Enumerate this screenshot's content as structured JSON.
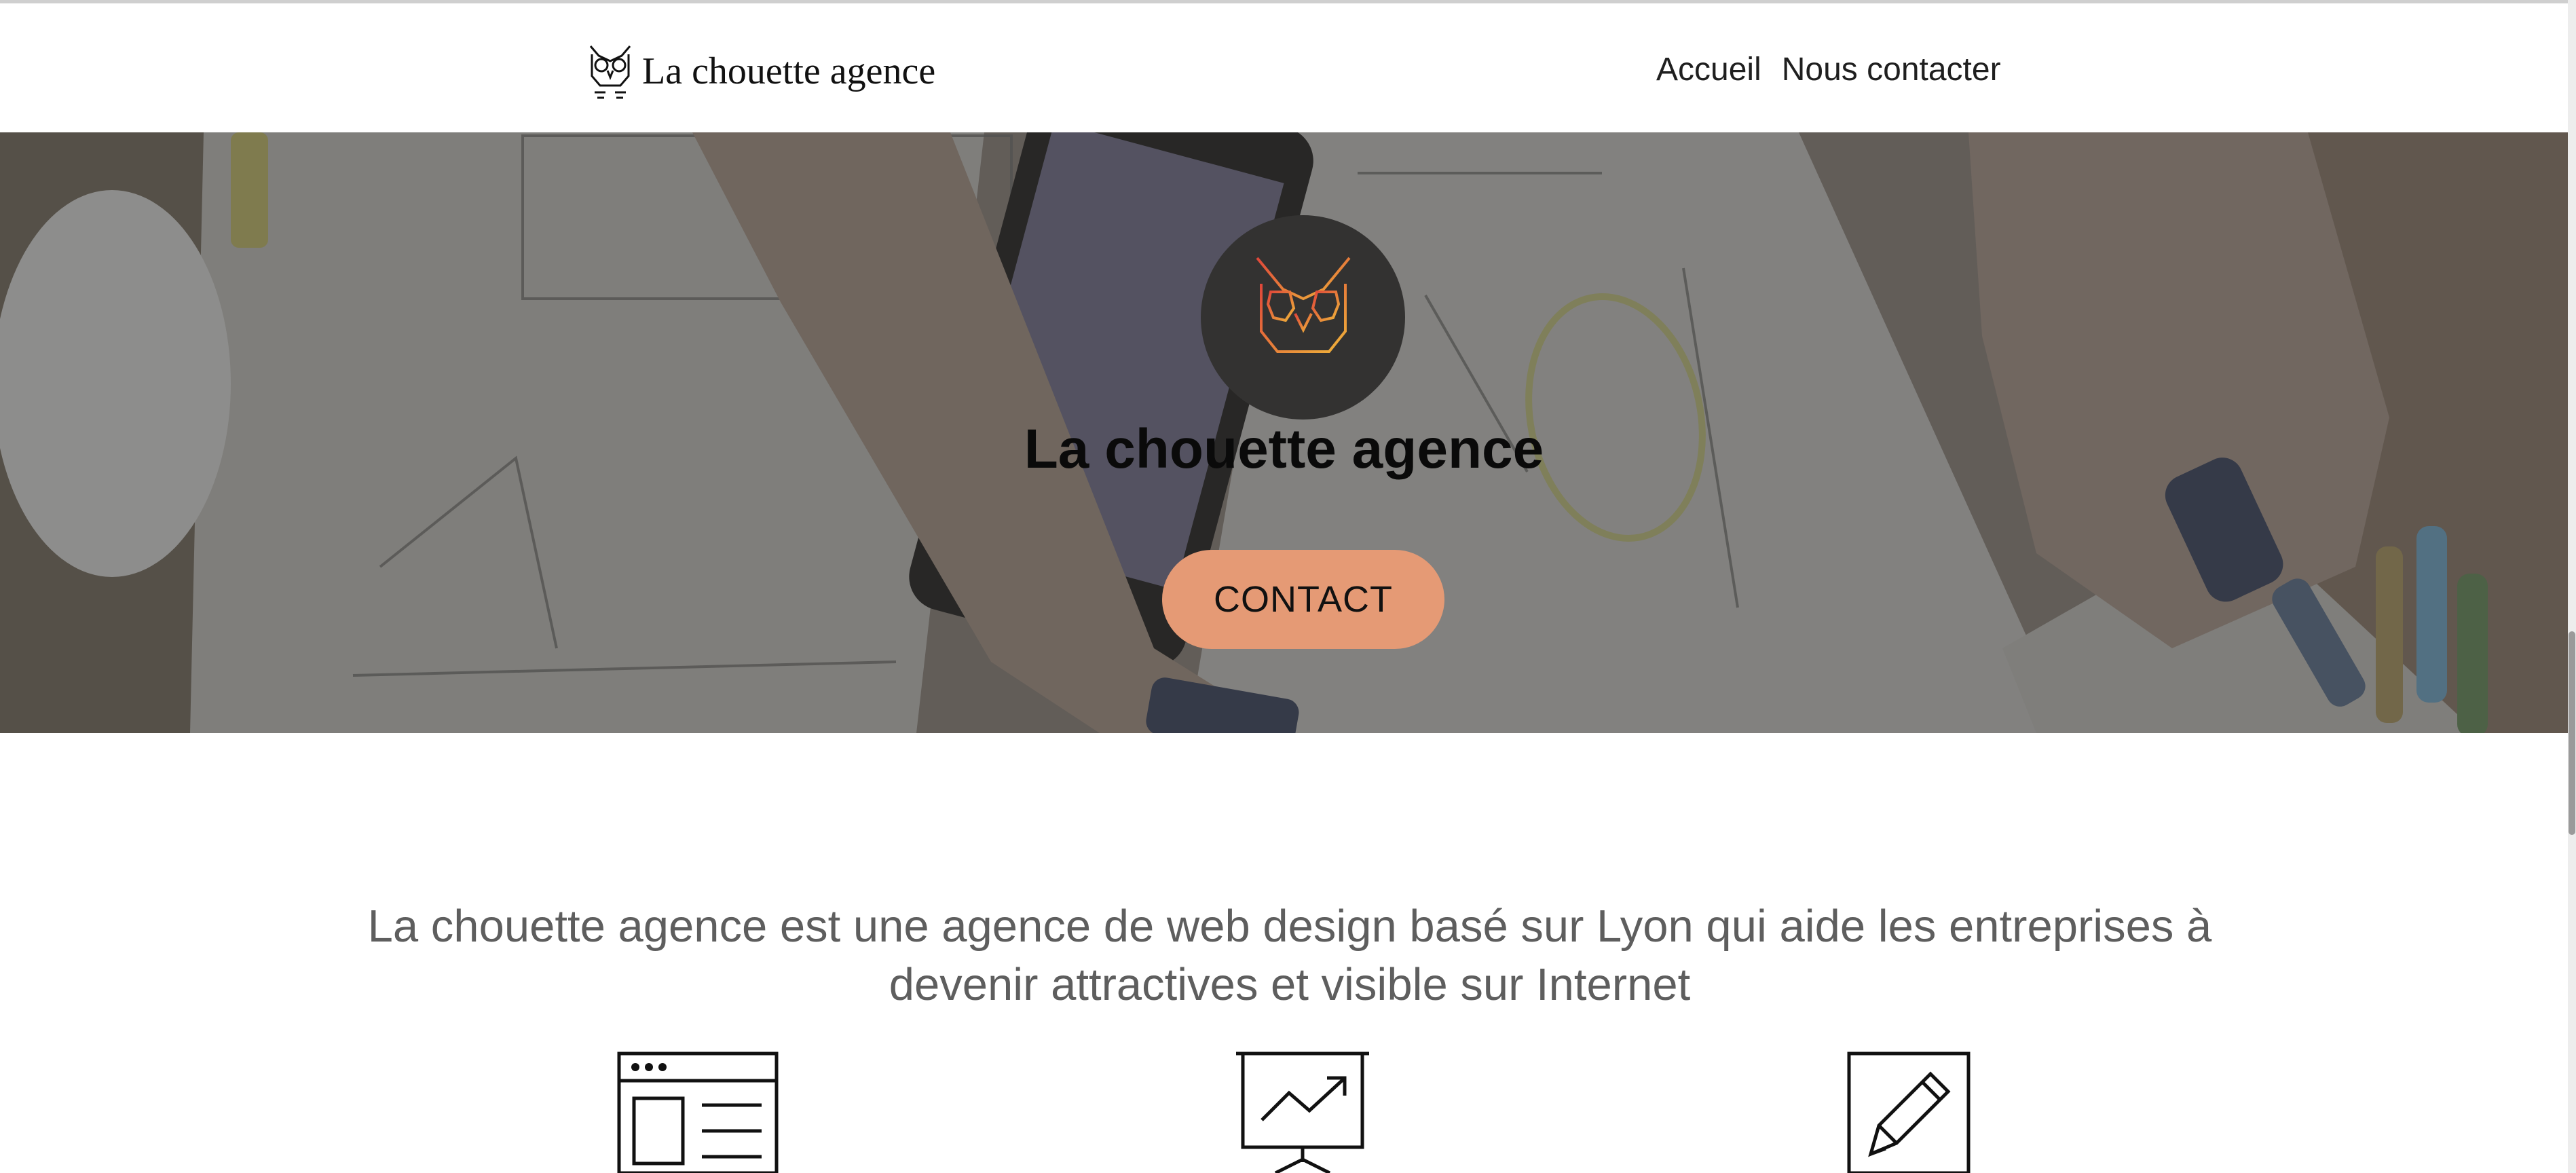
{
  "header": {
    "logo_text": "La chouette agence",
    "nav": [
      {
        "label": "Accueil"
      },
      {
        "label": "Nous contacter"
      }
    ]
  },
  "hero": {
    "title": "La chouette agence",
    "cta_label": "CONTACT",
    "emblem_icon": "owl-icon",
    "background": "desk-photo-overlay"
  },
  "intro": {
    "text": "La chouette agence est une agence de web design basé sur Lyon qui aide les entreprises à devenir attractives et visible sur Internet"
  },
  "services": [
    {
      "icon": "web-layout-icon"
    },
    {
      "icon": "presentation-chart-icon"
    },
    {
      "icon": "pencil-icon"
    }
  ],
  "colors": {
    "accent": "#e59a75",
    "emblem_bg": "#333231",
    "text_muted": "#5e5e5e",
    "nav_text": "#1f1f1f"
  }
}
